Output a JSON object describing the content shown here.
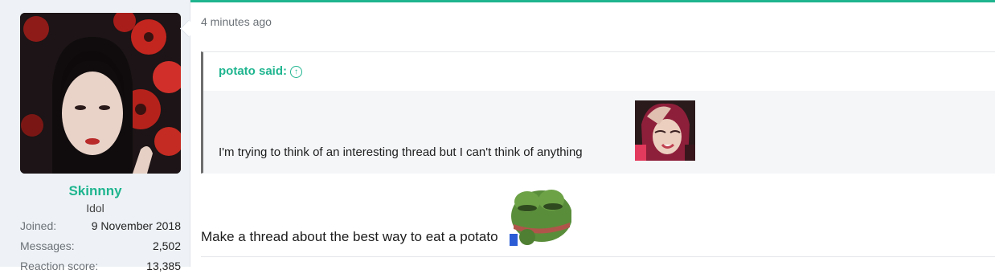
{
  "user": {
    "name": "Skinnny",
    "title": "Idol",
    "stats": [
      {
        "label": "Joined:",
        "value": "9 November 2018"
      },
      {
        "label": "Messages:",
        "value": "2,502"
      },
      {
        "label": "Reaction score:",
        "value": "13,385"
      }
    ]
  },
  "post": {
    "time": "4 minutes ago",
    "quote": {
      "author_label": "potato said:",
      "text": "I'm trying to think of an interesting thread but I can't think of anything"
    },
    "body": "Make a thread about the best way to eat a potato"
  },
  "colors": {
    "accent": "#1fb58f",
    "sidebar": "#eef2f6",
    "quote_bar": "#6e6e6e"
  }
}
